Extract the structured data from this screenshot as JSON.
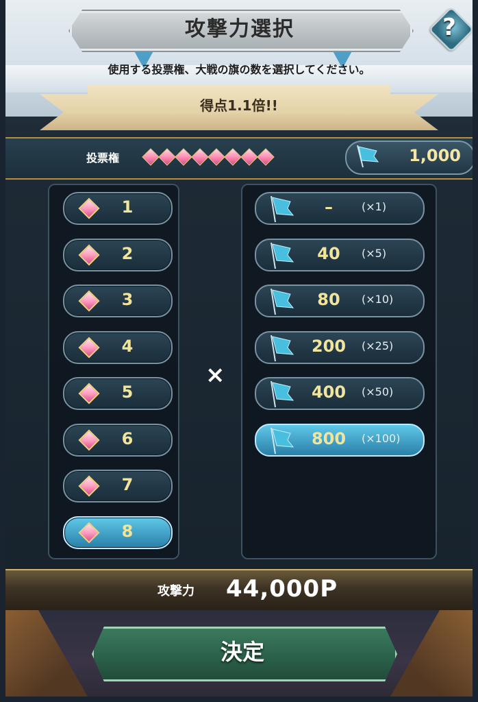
{
  "header": {
    "title": "攻撃力選択",
    "help_label": "?"
  },
  "instruction": "使用する投票権、大戦の旗の数を選択してください。",
  "bonus": "得点1.1倍!!",
  "vote": {
    "label": "投票権",
    "gem_count": 8
  },
  "flags": {
    "count": "1,000"
  },
  "left_options": [
    "1",
    "2",
    "3",
    "4",
    "5",
    "6",
    "7",
    "8"
  ],
  "left_selected_index": 7,
  "times_symbol": "×",
  "right_options": [
    {
      "value": "–",
      "mult": "(×1)"
    },
    {
      "value": "40",
      "mult": "(×5)"
    },
    {
      "value": "80",
      "mult": "(×10)"
    },
    {
      "value": "200",
      "mult": "(×25)"
    },
    {
      "value": "400",
      "mult": "(×50)"
    },
    {
      "value": "800",
      "mult": "(×100)"
    }
  ],
  "right_selected_index": 5,
  "attack": {
    "label": "攻撃力",
    "value": "44,000P"
  },
  "decide_label": "決定",
  "colors": {
    "accent_gold": "#f1e49c",
    "selected_cyan": "#5fc8e8",
    "decide_green": "#3b7a5e"
  }
}
